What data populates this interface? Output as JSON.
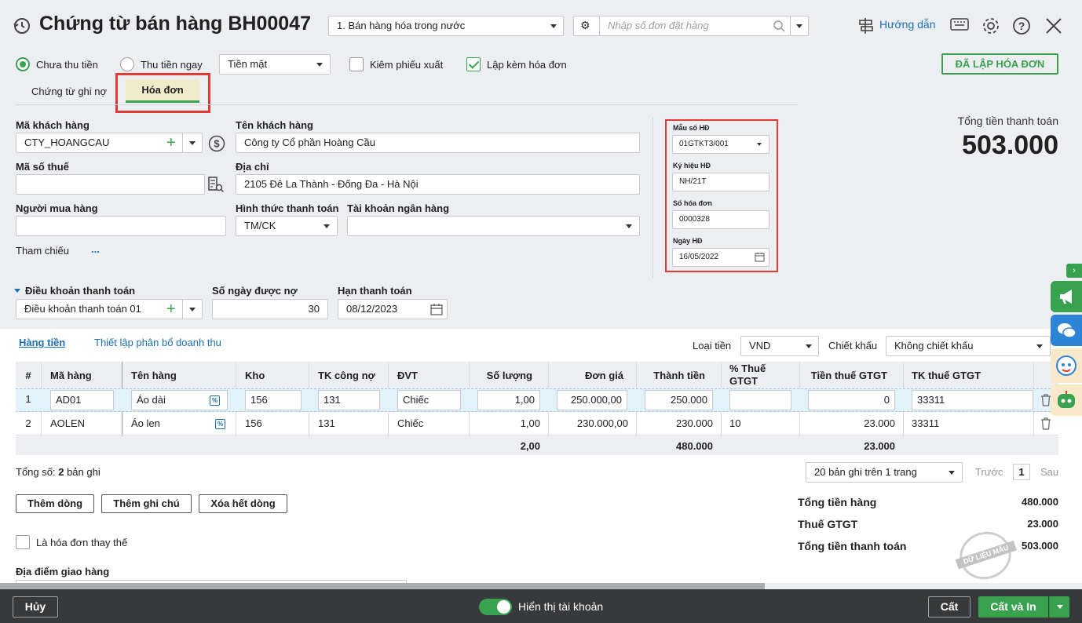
{
  "header": {
    "title": "Chứng từ bán hàng BH00047",
    "sale_type": "1. Bán hàng hóa trong nước",
    "order_search_placeholder": "Nhập số đơn đặt hàng",
    "guide_label": "Hướng dẫn"
  },
  "options": {
    "radio_unpaid": "Chưa thu tiền",
    "radio_paid": "Thu tiền ngay",
    "payment_method": "Tiền mặt",
    "check_export": "Kiêm phiếu xuất",
    "check_invoice": "Lập kèm hóa đơn",
    "invoice_status": "ĐÃ LẬP HÓA ĐƠN"
  },
  "tabs": {
    "debit": "Chứng từ ghi nợ",
    "invoice": "Hóa đơn"
  },
  "customer": {
    "code_label": "Mã khách hàng",
    "code": "CTY_HOANGCAU",
    "name_label": "Tên khách hàng",
    "name": "Công ty Cổ phần Hoàng Cầu",
    "tax_label": "Mã số thuế",
    "tax": "",
    "address_label": "Địa chỉ",
    "address": "2105 Đê La Thành - Đống Đa - Hà Nội",
    "buyer_label": "Người mua hàng",
    "buyer": "",
    "pay_form_label": "Hình thức thanh toán",
    "pay_form": "TM/CK",
    "bank_label": "Tài khoản ngân hàng",
    "bank": "",
    "ref_label": "Tham chiếu",
    "ref_more": "..."
  },
  "invoice_box": {
    "template_label": "Mẫu số HĐ",
    "template": "01GTKT3/001",
    "symbol_label": "Ký hiệu HĐ",
    "symbol": "NH/21T",
    "number_label": "Số hóa đơn",
    "number": "0000328",
    "date_label": "Ngày HĐ",
    "date": "16/05/2022"
  },
  "total_box": {
    "label": "Tổng tiền thanh toán",
    "value": "503.000"
  },
  "terms": {
    "label": "Điều khoản thanh toán",
    "value": "Điều khoản thanh toán 01",
    "days_label": "Số ngày được nợ",
    "days": "30",
    "due_label": "Hạn thanh toán",
    "due": "08/12/2023"
  },
  "goods_tabs": {
    "goods": "Hàng tiền",
    "allocation": "Thiết lập phân bổ doanh thu"
  },
  "currency": {
    "label": "Loại tiền",
    "value": "VND",
    "discount_label": "Chiết khấu",
    "discount": "Không chiết khấu"
  },
  "table": {
    "headers": [
      "#",
      "Mã hàng",
      "Tên hàng",
      "Kho",
      "TK công nợ",
      "ĐVT",
      "Số lượng",
      "Đơn giá",
      "Thành tiền",
      "% Thuế GTGT",
      "Tiền thuế GTGT",
      "TK thuế GTGT"
    ],
    "rows": [
      [
        "1",
        "AD01",
        "Áo dài",
        "156",
        "131",
        "Chiếc",
        "1,00",
        "250.000,00",
        "250.000",
        "",
        "0",
        "33311"
      ],
      [
        "2",
        "AOLEN",
        "Áo len",
        "156",
        "131",
        "Chiếc",
        "1,00",
        "230.000,00",
        "230.000",
        "10",
        "23.000",
        "33311"
      ]
    ],
    "totals": {
      "qty": "2,00",
      "amount": "480.000",
      "vat": "23.000"
    }
  },
  "footer_info": {
    "record_count_prefix": "Tổng số:",
    "record_count": "2",
    "record_count_suffix": "bản ghi",
    "page_size": "20 bản ghi trên 1 trang",
    "prev": "Trước",
    "page": "1",
    "next": "Sau"
  },
  "actions": {
    "add_row": "Thêm dòng",
    "add_note": "Thêm ghi chú",
    "clear_rows": "Xóa hết dòng"
  },
  "replace_invoice": "Là hóa đơn thay thế",
  "delivery_label": "Địa điểm giao hàng",
  "summary": {
    "goods_label": "Tổng tiền hàng",
    "goods": "480.000",
    "vat_label": "Thuế GTGT",
    "vat": "23.000",
    "total_label": "Tổng tiền thanh toán",
    "total": "503.000"
  },
  "stamp": "DỮ LIỆU MẪU",
  "bottom": {
    "cancel": "Hủy",
    "show_account": "Hiển thị tài khoản",
    "save": "Cất",
    "save_print": "Cất và In"
  },
  "colors": {
    "accent": "#38a24f",
    "link": "#1a6fb5",
    "highlight": "#e53935"
  }
}
